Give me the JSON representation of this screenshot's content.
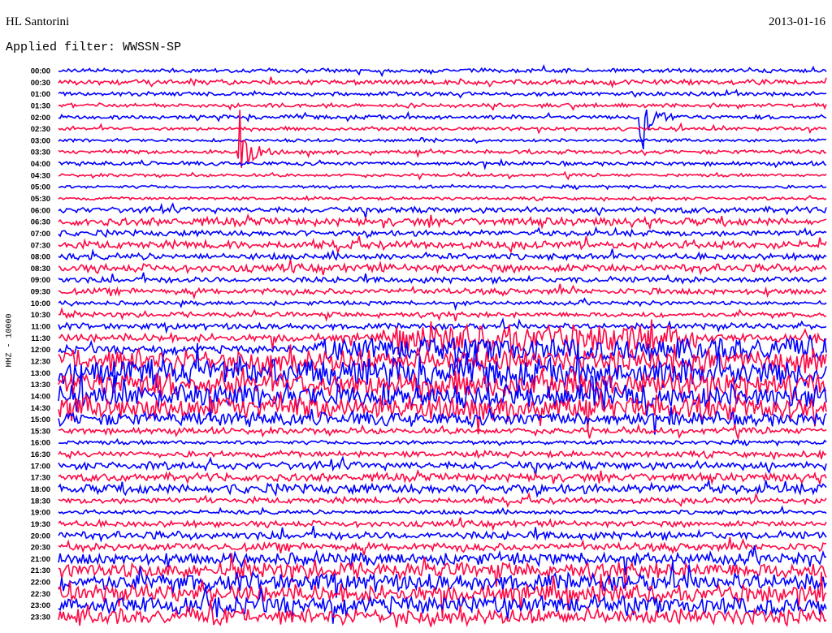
{
  "header": {
    "station": "HL Santorini",
    "date": "2013-01-16",
    "filter": "Applied filter: WWSSN-SP",
    "channel_label": "HHZ - 10000"
  },
  "chart_data": {
    "type": "helicorder",
    "title": "HL Santorini",
    "date": "2013-01-16",
    "ylabel": "HHZ - 10000",
    "minutes_per_line": 30,
    "colors": [
      "#0000ff",
      "#ff0844"
    ],
    "rows": [
      {
        "label": "00:00",
        "amp": 2
      },
      {
        "label": "00:30",
        "amp": 2.5
      },
      {
        "label": "01:00",
        "amp": 2
      },
      {
        "label": "01:30",
        "amp": 2
      },
      {
        "label": "02:00",
        "amp": 2
      },
      {
        "label": "02:30",
        "amp": 1.8
      },
      {
        "label": "03:00",
        "amp": 1.5
      },
      {
        "label": "03:30",
        "amp": 2
      },
      {
        "label": "04:00",
        "amp": 2
      },
      {
        "label": "04:30",
        "amp": 1.5
      },
      {
        "label": "05:00",
        "amp": 1.5
      },
      {
        "label": "05:30",
        "amp": 1.5
      },
      {
        "label": "06:00",
        "amp": 3
      },
      {
        "label": "06:30",
        "amp": 4
      },
      {
        "label": "07:00",
        "amp": 3
      },
      {
        "label": "07:30",
        "amp": 4
      },
      {
        "label": "08:00",
        "amp": 3
      },
      {
        "label": "08:30",
        "amp": 4
      },
      {
        "label": "09:00",
        "amp": 3
      },
      {
        "label": "09:30",
        "amp": 3
      },
      {
        "label": "10:00",
        "amp": 2
      },
      {
        "label": "10:30",
        "amp": 2.5
      },
      {
        "label": "11:00",
        "amp": 3
      },
      {
        "label": "11:30",
        "amp": 4,
        "burst": [
          13,
          25,
          12
        ]
      },
      {
        "label": "12:00",
        "amp": 4,
        "burst": [
          10,
          30,
          9
        ]
      },
      {
        "label": "12:30",
        "amp": 12
      },
      {
        "label": "13:00",
        "amp": 14
      },
      {
        "label": "13:30",
        "amp": 13
      },
      {
        "label": "14:00",
        "amp": 12
      },
      {
        "label": "14:30",
        "amp": 12
      },
      {
        "label": "15:00",
        "amp": 7
      },
      {
        "label": "15:30",
        "amp": 3
      },
      {
        "label": "16:00",
        "amp": 2
      },
      {
        "label": "16:30",
        "amp": 3
      },
      {
        "label": "17:00",
        "amp": 4
      },
      {
        "label": "17:30",
        "amp": 4
      },
      {
        "label": "18:00",
        "amp": 5
      },
      {
        "label": "18:30",
        "amp": 3
      },
      {
        "label": "19:00",
        "amp": 2
      },
      {
        "label": "19:30",
        "amp": 3
      },
      {
        "label": "20:00",
        "amp": 4
      },
      {
        "label": "20:30",
        "amp": 4
      },
      {
        "label": "21:00",
        "amp": 6
      },
      {
        "label": "21:30",
        "amp": 8
      },
      {
        "label": "22:00",
        "amp": 9
      },
      {
        "label": "22:30",
        "amp": 9
      },
      {
        "label": "23:00",
        "amp": 9
      },
      {
        "label": "23:30",
        "amp": 8
      }
    ],
    "events": [
      {
        "row": "02:00",
        "minute": 22.7,
        "amp": 75
      },
      {
        "row": "03:30",
        "minute": 7.0,
        "amp": 70
      }
    ]
  }
}
